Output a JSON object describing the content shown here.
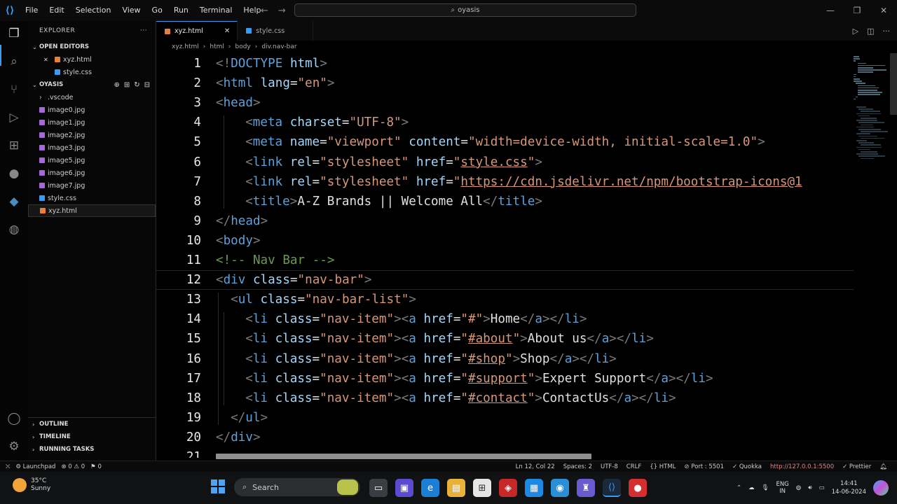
{
  "titlebar": {
    "menu": [
      "File",
      "Edit",
      "Selection",
      "View",
      "Go",
      "Run",
      "Terminal",
      "Help"
    ],
    "search": "oyasis"
  },
  "sidebar": {
    "header": "EXPLORER",
    "open_editors_label": "OPEN EDITORS",
    "open_editors": [
      {
        "name": "xyz.html",
        "close": "✕",
        "color": "#e6803a"
      },
      {
        "name": "style.css",
        "close": "",
        "color": "#3b9bf0"
      }
    ],
    "folder_label": "OYASIS",
    "files": [
      {
        "name": ".vscode",
        "color": "",
        "chevron": "›"
      },
      {
        "name": "image0.jpg",
        "color": "#a56ad8"
      },
      {
        "name": "image1.jpg",
        "color": "#a56ad8"
      },
      {
        "name": "image2.jpg",
        "color": "#a56ad8"
      },
      {
        "name": "image3.jpg",
        "color": "#a56ad8"
      },
      {
        "name": "image5.jpg",
        "color": "#a56ad8"
      },
      {
        "name": "image6.jpg",
        "color": "#a56ad8"
      },
      {
        "name": "image7.jpg",
        "color": "#a56ad8"
      },
      {
        "name": "style.css",
        "color": "#3b9bf0"
      },
      {
        "name": "xyz.html",
        "color": "#e6803a"
      }
    ],
    "bottom_sections": [
      "OUTLINE",
      "TIMELINE",
      "RUNNING TASKS"
    ]
  },
  "tabs": [
    {
      "name": "xyz.html",
      "active": true,
      "close": "✕",
      "color": "#e6803a"
    },
    {
      "name": "style.css",
      "active": false,
      "close": "",
      "color": "#3b9bf0"
    }
  ],
  "breadcrumb": [
    "xyz.html",
    "html",
    "body",
    "div.nav-bar"
  ],
  "code": {
    "current_line": 12,
    "lines": [
      {
        "n": "1",
        "i": 0,
        "p": [
          [
            "tg",
            "<!"
          ],
          [
            "tn",
            "DOCTYPE "
          ],
          [
            "at",
            "html"
          ],
          [
            "tg",
            ">"
          ]
        ]
      },
      {
        "n": "2",
        "i": 0,
        "p": [
          [
            "tg",
            "<"
          ],
          [
            "tn",
            "html "
          ],
          [
            "at",
            "lang"
          ],
          [
            "tx",
            "="
          ],
          [
            "st",
            "\"en\""
          ],
          [
            "tg",
            ">"
          ]
        ]
      },
      {
        "n": "3",
        "i": 0,
        "p": [
          [
            "tg",
            "<"
          ],
          [
            "tn",
            "head"
          ],
          [
            "tg",
            ">"
          ]
        ]
      },
      {
        "n": "4",
        "i": 2,
        "p": [
          [
            "tg",
            "<"
          ],
          [
            "tn",
            "meta "
          ],
          [
            "at",
            "charset"
          ],
          [
            "tx",
            "="
          ],
          [
            "st",
            "\"UTF-8\""
          ],
          [
            "tg",
            ">"
          ]
        ]
      },
      {
        "n": "5",
        "i": 2,
        "p": [
          [
            "tg",
            "<"
          ],
          [
            "tn",
            "meta "
          ],
          [
            "at",
            "name"
          ],
          [
            "tx",
            "="
          ],
          [
            "st",
            "\"viewport\" "
          ],
          [
            "at",
            "content"
          ],
          [
            "tx",
            "="
          ],
          [
            "st",
            "\"width=device-width, initial-scale=1.0\""
          ],
          [
            "tg",
            ">"
          ]
        ]
      },
      {
        "n": "6",
        "i": 2,
        "p": [
          [
            "tg",
            "<"
          ],
          [
            "tn",
            "link "
          ],
          [
            "at",
            "rel"
          ],
          [
            "tx",
            "="
          ],
          [
            "st",
            "\"stylesheet\" "
          ],
          [
            "at",
            "href"
          ],
          [
            "tx",
            "="
          ],
          [
            "st",
            "\""
          ],
          [
            "lk",
            "style.css"
          ],
          [
            "st",
            "\""
          ],
          [
            "tg",
            ">"
          ]
        ]
      },
      {
        "n": "7",
        "i": 2,
        "p": [
          [
            "tg",
            "<"
          ],
          [
            "tn",
            "link "
          ],
          [
            "at",
            "rel"
          ],
          [
            "tx",
            "="
          ],
          [
            "st",
            "\"stylesheet\" "
          ],
          [
            "at",
            "href"
          ],
          [
            "tx",
            "="
          ],
          [
            "st",
            "\""
          ],
          [
            "lk",
            "https://cdn.jsdelivr.net/npm/bootstrap-icons@1"
          ]
        ]
      },
      {
        "n": "8",
        "i": 2,
        "p": [
          [
            "tg",
            "<"
          ],
          [
            "tn",
            "title"
          ],
          [
            "tg",
            ">"
          ],
          [
            "tx",
            "A-Z Brands || Welcome All"
          ],
          [
            "tg",
            "</"
          ],
          [
            "tn",
            "title"
          ],
          [
            "tg",
            ">"
          ]
        ]
      },
      {
        "n": "9",
        "i": 0,
        "p": [
          [
            "tg",
            "</"
          ],
          [
            "tn",
            "head"
          ],
          [
            "tg",
            ">"
          ]
        ]
      },
      {
        "n": "10",
        "i": 0,
        "p": [
          [
            "tg",
            "<"
          ],
          [
            "tn",
            "body"
          ],
          [
            "tg",
            ">"
          ]
        ]
      },
      {
        "n": "11",
        "i": 0,
        "p": [
          [
            "cm",
            "<!-- Nav Bar -->"
          ]
        ]
      },
      {
        "n": "12",
        "i": 0,
        "p": [
          [
            "tg",
            "<"
          ],
          [
            "tn",
            "div "
          ],
          [
            "at",
            "class"
          ],
          [
            "tx",
            "="
          ],
          [
            "st",
            "\"nav-bar\""
          ],
          [
            "tg",
            ">"
          ]
        ]
      },
      {
        "n": "13",
        "i": 1,
        "p": [
          [
            "tg",
            "<"
          ],
          [
            "tn",
            "ul "
          ],
          [
            "at",
            "class"
          ],
          [
            "tx",
            "="
          ],
          [
            "st",
            "\"nav-bar-list\""
          ],
          [
            "tg",
            ">"
          ]
        ]
      },
      {
        "n": "14",
        "i": 2,
        "p": [
          [
            "tg",
            "<"
          ],
          [
            "tn",
            "li "
          ],
          [
            "at",
            "class"
          ],
          [
            "tx",
            "="
          ],
          [
            "st",
            "\"nav-item\""
          ],
          [
            "tg",
            "><"
          ],
          [
            "tn",
            "a "
          ],
          [
            "at",
            "href"
          ],
          [
            "tx",
            "="
          ],
          [
            "st",
            "\"#\""
          ],
          [
            "tg",
            ">"
          ],
          [
            "tx",
            "Home"
          ],
          [
            "tg",
            "</"
          ],
          [
            "tn",
            "a"
          ],
          [
            "tg",
            "></"
          ],
          [
            "tn",
            "li"
          ],
          [
            "tg",
            ">"
          ]
        ]
      },
      {
        "n": "15",
        "i": 2,
        "p": [
          [
            "tg",
            "<"
          ],
          [
            "tn",
            "li "
          ],
          [
            "at",
            "class"
          ],
          [
            "tx",
            "="
          ],
          [
            "st",
            "\"nav-item\""
          ],
          [
            "tg",
            "><"
          ],
          [
            "tn",
            "a "
          ],
          [
            "at",
            "href"
          ],
          [
            "tx",
            "="
          ],
          [
            "st",
            "\""
          ],
          [
            "lk",
            "#about"
          ],
          [
            "st",
            "\""
          ],
          [
            "tg",
            ">"
          ],
          [
            "tx",
            "About us"
          ],
          [
            "tg",
            "</"
          ],
          [
            "tn",
            "a"
          ],
          [
            "tg",
            "></"
          ],
          [
            "tn",
            "li"
          ],
          [
            "tg",
            ">"
          ]
        ]
      },
      {
        "n": "16",
        "i": 2,
        "p": [
          [
            "tg",
            "<"
          ],
          [
            "tn",
            "li "
          ],
          [
            "at",
            "class"
          ],
          [
            "tx",
            "="
          ],
          [
            "st",
            "\"nav-item\""
          ],
          [
            "tg",
            "><"
          ],
          [
            "tn",
            "a "
          ],
          [
            "at",
            "href"
          ],
          [
            "tx",
            "="
          ],
          [
            "st",
            "\""
          ],
          [
            "lk",
            "#shop"
          ],
          [
            "st",
            "\""
          ],
          [
            "tg",
            ">"
          ],
          [
            "tx",
            "Shop"
          ],
          [
            "tg",
            "</"
          ],
          [
            "tn",
            "a"
          ],
          [
            "tg",
            "></"
          ],
          [
            "tn",
            "li"
          ],
          [
            "tg",
            ">"
          ]
        ]
      },
      {
        "n": "17",
        "i": 2,
        "p": [
          [
            "tg",
            "<"
          ],
          [
            "tn",
            "li "
          ],
          [
            "at",
            "class"
          ],
          [
            "tx",
            "="
          ],
          [
            "st",
            "\"nav-item\""
          ],
          [
            "tg",
            "><"
          ],
          [
            "tn",
            "a "
          ],
          [
            "at",
            "href"
          ],
          [
            "tx",
            "="
          ],
          [
            "st",
            "\""
          ],
          [
            "lk",
            "#support"
          ],
          [
            "st",
            "\""
          ],
          [
            "tg",
            ">"
          ],
          [
            "tx",
            "Expert Support"
          ],
          [
            "tg",
            "</"
          ],
          [
            "tn",
            "a"
          ],
          [
            "tg",
            "></"
          ],
          [
            "tn",
            "li"
          ],
          [
            "tg",
            ">"
          ]
        ]
      },
      {
        "n": "18",
        "i": 2,
        "p": [
          [
            "tg",
            "<"
          ],
          [
            "tn",
            "li "
          ],
          [
            "at",
            "class"
          ],
          [
            "tx",
            "="
          ],
          [
            "st",
            "\"nav-item\""
          ],
          [
            "tg",
            "><"
          ],
          [
            "tn",
            "a "
          ],
          [
            "at",
            "href"
          ],
          [
            "tx",
            "="
          ],
          [
            "st",
            "\""
          ],
          [
            "lk",
            "#contact"
          ],
          [
            "st",
            "\""
          ],
          [
            "tg",
            ">"
          ],
          [
            "tx",
            "ContactUs"
          ],
          [
            "tg",
            "</"
          ],
          [
            "tn",
            "a"
          ],
          [
            "tg",
            "></"
          ],
          [
            "tn",
            "li"
          ],
          [
            "tg",
            ">"
          ]
        ]
      },
      {
        "n": "19",
        "i": 1,
        "p": [
          [
            "tg",
            "</"
          ],
          [
            "tn",
            "ul"
          ],
          [
            "tg",
            ">"
          ]
        ]
      },
      {
        "n": "20",
        "i": 0,
        "p": [
          [
            "tg",
            "</"
          ],
          [
            "tn",
            "div"
          ],
          [
            "tg",
            ">"
          ]
        ]
      },
      {
        "n": "21",
        "i": 0,
        "p": []
      }
    ]
  },
  "statusbar": {
    "left": [
      "⛌",
      "⚙ Launchpad",
      "⊗ 0 ⚠ 0",
      "⚑ 0"
    ],
    "position": "Ln 12, Col 22",
    "spaces": "Spaces: 2",
    "encoding": "UTF-8",
    "eol": "CRLF",
    "language": "{} HTML",
    "port": "⊘ Port : 5501",
    "quokka": "✓ Quokka",
    "server": "http://127.0.0.1:5500",
    "prettier": "✓ Prettier"
  },
  "taskbar": {
    "temp": "35°C",
    "weather": "Sunny",
    "search_placeholder": "Search",
    "lang": "ENG",
    "region": "IN",
    "time": "14:41",
    "date": "14-06-2024"
  }
}
